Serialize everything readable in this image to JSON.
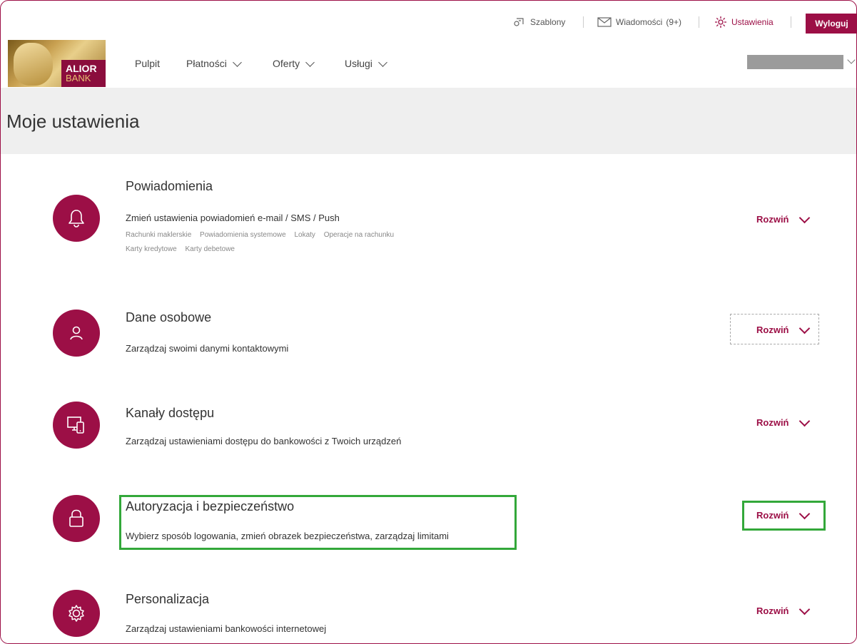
{
  "topbar": {
    "templates_label": "Szablony",
    "messages_label": "Wiadomości",
    "messages_count": "(9+)",
    "settings_label": "Ustawienia",
    "logout_label": "Wyloguj"
  },
  "logo": {
    "line1": "ALIOR",
    "line2": "BANK"
  },
  "nav": {
    "items": [
      {
        "label": "Pulpit"
      },
      {
        "label": "Płatności"
      },
      {
        "label": "Oferty"
      },
      {
        "label": "Usługi"
      }
    ]
  },
  "page": {
    "title": "Moje ustawienia"
  },
  "sections": [
    {
      "title": "Powiadomienia",
      "desc": "Zmień ustawienia powiadomień e-mail / SMS / Push",
      "tags": [
        "Rachunki maklerskie",
        "Powiadomienia systemowe",
        "Lokaty",
        "Operacje na rachunku",
        "Karty kredytowe",
        "Karty debetowe"
      ],
      "icon": "bell-icon",
      "expand": "Rozwiń"
    },
    {
      "title": "Dane osobowe",
      "desc": "Zarządzaj swoimi danymi kontaktowymi",
      "icon": "person-icon",
      "expand": "Rozwiń"
    },
    {
      "title": "Kanały dostępu",
      "desc": "Zarządzaj ustawieniami dostępu do bankowości z Twoich urządzeń",
      "icon": "devices-icon",
      "expand": "Rozwiń"
    },
    {
      "title": "Autoryzacja i bezpieczeństwo",
      "desc": "Wybierz sposób logowania, zmień obrazek bezpieczeństwa, zarządzaj limitami",
      "icon": "lock-icon",
      "expand": "Rozwiń"
    },
    {
      "title": "Personalizacja",
      "desc": "Zarządzaj ustawieniami bankowości internetowej",
      "icon": "gear-icon",
      "expand": "Rozwiń"
    }
  ],
  "colors": {
    "brand": "#9c0f46",
    "highlight": "#33a83a",
    "title_band": "#efefef"
  }
}
